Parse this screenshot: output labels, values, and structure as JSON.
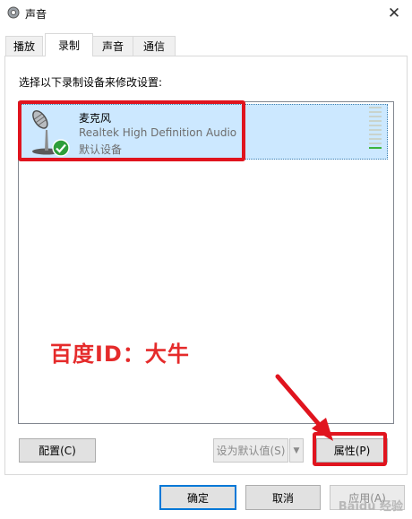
{
  "window": {
    "title": "声音",
    "close_glyph": "✕",
    "app_icon": "speaker-icon"
  },
  "tabs": [
    {
      "label": "播放",
      "active": false
    },
    {
      "label": "录制",
      "active": true
    },
    {
      "label": "声音",
      "active": false
    },
    {
      "label": "通信",
      "active": false
    }
  ],
  "panel": {
    "instruction": "选择以下录制设备来修改设置:",
    "devices": [
      {
        "name": "麦克风",
        "driver": "Realtek High Definition Audio",
        "status": "默认设备",
        "icon": "microphone-icon",
        "badge": "checkmark-icon",
        "selected": true
      }
    ],
    "buttons": {
      "configure": "配置(C)",
      "set_default": "设为默认值(S)",
      "set_default_arrow": "▼",
      "properties": "属性(P)"
    }
  },
  "annotation": {
    "text": "百度ID：大牛",
    "color": "#e52b2b"
  },
  "footer": {
    "ok": "确定",
    "cancel": "取消",
    "apply": "应用(A)"
  },
  "watermark": {
    "text": "Baidu 经验"
  },
  "colors": {
    "highlight": "#e0141e",
    "selection": "#cce8ff",
    "level_green": "#3cb43c",
    "accent": "#0078d7"
  }
}
